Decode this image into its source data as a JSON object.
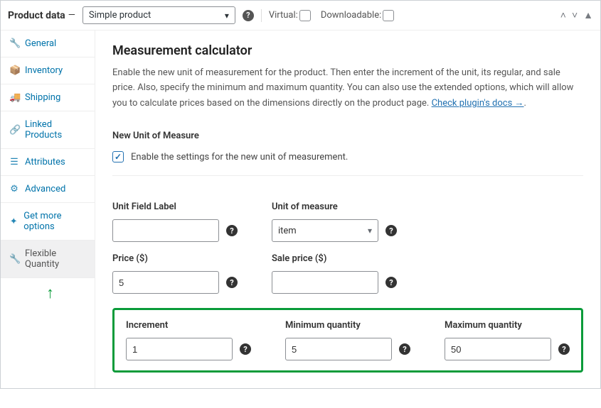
{
  "header": {
    "title": "Product data",
    "product_type": "Simple product",
    "virtual_label": "Virtual:",
    "downloadable_label": "Downloadable:"
  },
  "sidebar": {
    "items": [
      {
        "icon": "🔧",
        "label": "General"
      },
      {
        "icon": "📦",
        "label": "Inventory"
      },
      {
        "icon": "🚚",
        "label": "Shipping"
      },
      {
        "icon": "🔗",
        "label": "Linked Products"
      },
      {
        "icon": "☰",
        "label": "Attributes"
      },
      {
        "icon": "⚙",
        "label": "Advanced"
      },
      {
        "icon": "✦",
        "label": "Get more options"
      },
      {
        "icon": "🔧",
        "label": "Flexible Quantity"
      }
    ]
  },
  "content": {
    "heading": "Measurement calculator",
    "description": "Enable the new unit of measurement for the product. Then enter the increment of the unit, its regular, and sale price. Also, specify the minimum and maximum quantity. You can also use the extended options, which will allow you to calculate prices based on the dimensions directly on the product page. ",
    "docs_link": "Check plugin's docs →",
    "section_label": "New Unit of Measure",
    "enable_label": "Enable the settings for the new unit of measurement.",
    "fields": {
      "unit_label": {
        "label": "Unit Field Label",
        "value": ""
      },
      "unit_measure": {
        "label": "Unit of measure",
        "value": "item"
      },
      "price": {
        "label": "Price ($)",
        "value": "5"
      },
      "sale_price": {
        "label": "Sale price ($)",
        "value": ""
      },
      "increment": {
        "label": "Increment",
        "value": "1"
      },
      "min_qty": {
        "label": "Minimum quantity",
        "value": "5"
      },
      "max_qty": {
        "label": "Maximum quantity",
        "value": "50"
      }
    }
  }
}
